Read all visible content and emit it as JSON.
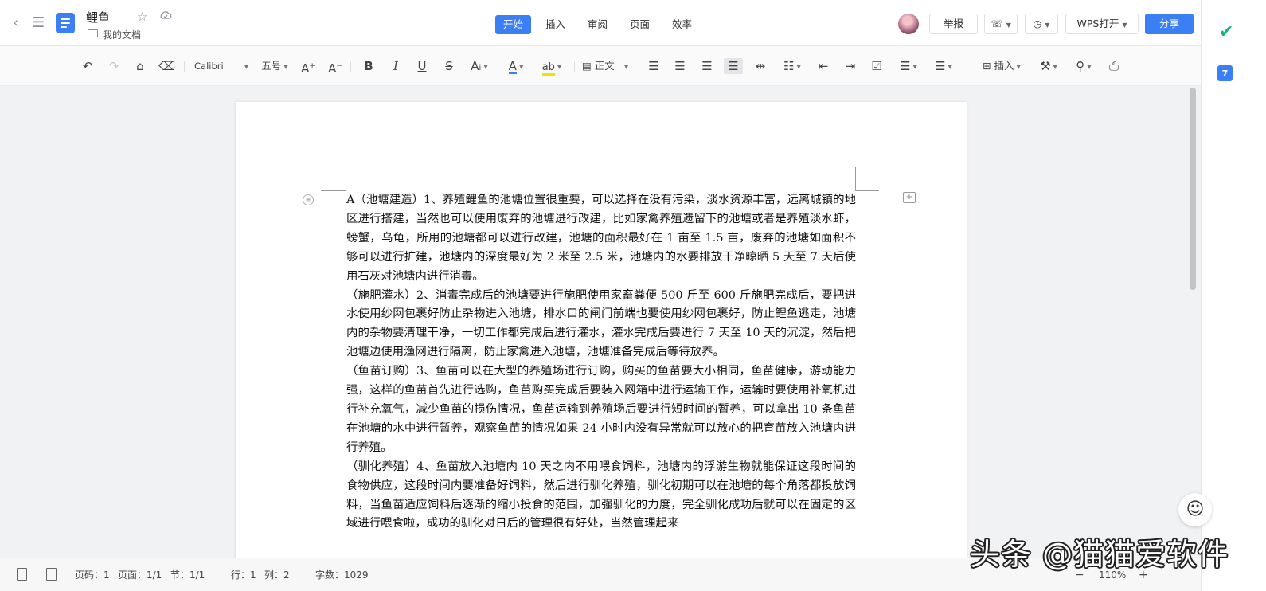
{
  "titlebar": {
    "doc_title": "鲤鱼",
    "folder": "我的文档",
    "tabs": [
      "开始",
      "插入",
      "审阅",
      "页面",
      "效率"
    ],
    "active_tab": "开始",
    "report_label": "举报",
    "wps_open_label": "WPS打开",
    "share_label": "分享",
    "accent_color": "#3c7ff5"
  },
  "toolbar": {
    "font_name": "Calibri",
    "font_size": "五号",
    "style_label": "正文",
    "insert_label": "插入",
    "font_color": "#3c7ff5",
    "highlight_color": "#f5e100"
  },
  "document": {
    "paragraphs": [
      "A（池塘建造）1、养殖鲤鱼的池塘位置很重要，可以选择在没有污染，淡水资源丰富，远离城镇的地区进行搭建，当然也可以使用废弃的池塘进行改建，比如家禽养殖遗留下的池塘或者是养殖淡水虾，螃蟹，乌龟，所用的池塘都可以进行改建，池塘的面积最好在 1 亩至 1.5 亩，废弃的池塘如面积不够可以进行扩建，池塘内的深度最好为 2 米至 2.5 米，池塘内的水要排放干净晾晒 5 天至 7 天后使用石灰对池塘内进行消毒。",
      "（施肥灌水）2、消毒完成后的池塘要进行施肥使用家畜粪便 500 斤至 600 斤施肥完成后，要把进水使用纱网包裹好防止杂物进入池塘，排水口的闸门前端也要使用纱网包裹好，防止鲤鱼逃走，池塘内的杂物要清理干净，一切工作都完成后进行灌水，灌水完成后要进行 7 天至 10 天的沉淀，然后把池塘边使用渔网进行隔离，防止家禽进入池塘，池塘准备完成后等待放养。",
      "（鱼苗订购）3、鱼苗可以在大型的养殖场进行订购，购买的鱼苗要大小相同，鱼苗健康，游动能力强，这样的鱼苗首先进行选购，鱼苗购买完成后要装入网箱中进行运输工作，运输时要使用补氧机进行补充氧气，减少鱼苗的损伤情况，鱼苗运输到养殖场后要进行短时间的暂养，可以拿出 10 条鱼苗在池塘的水中进行暂养，观察鱼苗的情况如果 24 小时内没有异常就可以放心的把育苗放入池塘内进行养殖。",
      "（驯化养殖）4、鱼苗放入池塘内 10 天之内不用喂食饲料，池塘内的浮游生物就能保证这段时间的食物供应，这段时间内要准备好饲料，然后进行驯化养殖，驯化初期可以在池塘的每个角落都投放饲料，当鱼苗适应饲料后逐渐的缩小投食的范围，加强驯化的力度，完全驯化成功后就可以在固定的区域进行喂食啦，成功的驯化对日后的管理很有好处，当然管理起来"
    ]
  },
  "statusbar": {
    "page_code": "页码：1",
    "page": "页面：1/1",
    "section": "节：1/1",
    "row": "行：1",
    "col": "列：2",
    "word_count": "字数：1029",
    "zoom": "110%"
  },
  "watermark": "头条 @猫猫爱软件"
}
